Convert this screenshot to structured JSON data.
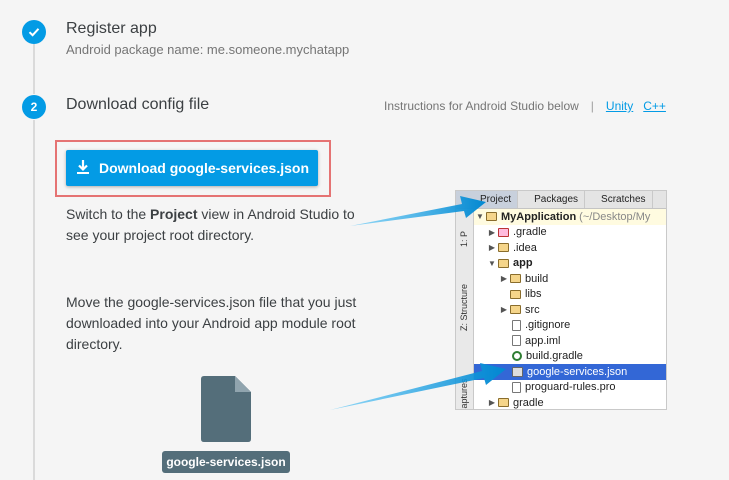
{
  "steps": [
    {
      "number": "✓",
      "title": "Register app",
      "subtitle": "Android package name: me.someone.mychatapp"
    },
    {
      "number": "2",
      "title": "Download config file"
    }
  ],
  "instructions": {
    "text": "Instructions for Android Studio below",
    "separator": "|",
    "links": [
      "Unity",
      "C++"
    ]
  },
  "download_button": {
    "label": "Download google-services.json"
  },
  "paragraphs": {
    "p1_before": "Switch to the ",
    "p1_bold": "Project",
    "p1_after": " view in Android Studio to see your project root directory.",
    "p2": "Move the google-services.json file that you just downloaded into your Android app module root directory."
  },
  "file": {
    "label": "google-services.json"
  },
  "ide": {
    "tabs": [
      "Project",
      "Packages",
      "Scratches"
    ],
    "side_labels": [
      "1: P",
      "Z: Structure",
      "Captures"
    ],
    "root": {
      "name": "MyApplication",
      "path": "(~/Desktop/My"
    },
    "tree": [
      ".gradle",
      ".idea",
      "app",
      "build",
      "libs",
      "src",
      ".gitignore",
      "app.iml",
      "build.gradle",
      "google-services.json",
      "proguard-rules.pro",
      "gradle"
    ]
  },
  "colors": {
    "accent": "#039be5",
    "highlight_frame": "#e57373",
    "tree_selection": "#3367d6",
    "file_chip": "#546e7a"
  }
}
